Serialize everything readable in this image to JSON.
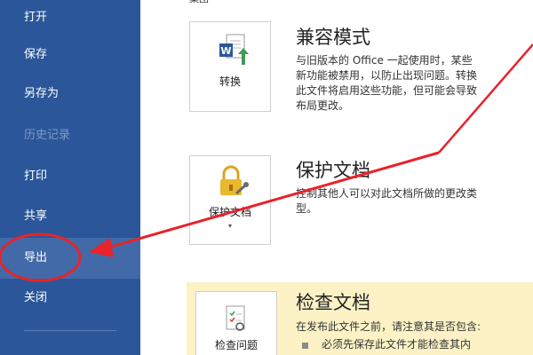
{
  "sidebar": {
    "items": [
      {
        "label": "打开",
        "state": "normal"
      },
      {
        "label": "保存",
        "state": "normal"
      },
      {
        "label": "另存为",
        "state": "normal"
      },
      {
        "label": "历史记录",
        "state": "disabled"
      },
      {
        "label": "打印",
        "state": "normal"
      },
      {
        "label": "共享",
        "state": "normal"
      },
      {
        "label": "导出",
        "state": "selected"
      },
      {
        "label": "关闭",
        "state": "normal"
      }
    ]
  },
  "main": {
    "group_title": "集团",
    "sections": [
      {
        "button_label": "转换",
        "button_icon": "word-convert-icon",
        "title": "兼容模式",
        "description_lines": [
          "与旧版本的 Office 一起使用时，某些",
          "新功能被禁用，以防止出现问题。转换",
          "此文件将启用这些功能，但可能会导致",
          "布局更改。"
        ]
      },
      {
        "button_label": "保护文档",
        "button_icon": "lock-key-icon",
        "title": "保护文档",
        "description_lines": [
          "控制其他人可以对此文档所做的更改类",
          "型。"
        ]
      },
      {
        "button_label": "检查问题",
        "button_icon": "inspect-document-icon",
        "title": "检查文档",
        "description_lines": [
          "在发布此文件之前，请注意其是否包含:"
        ],
        "bullets": [
          "必须先保存此文件才能检查其内"
        ]
      }
    ]
  },
  "colors": {
    "sidebar_bg": "#2b579a",
    "sidebar_selected": "#426aa8",
    "highlight_bg": "#fcf2c6",
    "annotation_red": "#e8232a"
  }
}
